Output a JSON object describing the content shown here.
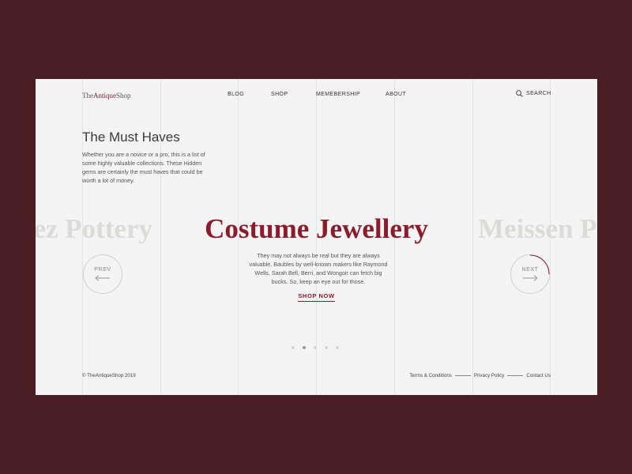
{
  "logo": {
    "prefix": "The",
    "accent": "Antique",
    "suffix": "Shop"
  },
  "nav": [
    "BLOG",
    "SHOP",
    "MEMEBERSHIP",
    "ABOUT"
  ],
  "search_label": "SEARCH",
  "intro": {
    "title": "The Must Haves",
    "text": "Whether you are a novice or a pro, this is a list of some highly valuable collections. These Hidden gems are certainly the must haves that could be worth a lot of money."
  },
  "carousel": {
    "prev_item": "nez Pottery",
    "current_item": "Costume Jewellery",
    "next_item": "Meissen P",
    "description": "They may not always be real but they are always valuable. Baubles by well-known makers like Raymond Wells, Sarah Bell, Berri, and Wongoir can fetch big bucks. So, keep an eye out for those.",
    "cta": "SHOP NOW",
    "prev_label": "PREV",
    "next_label": "NEXT",
    "dot_count": 5,
    "active_index": 1
  },
  "footer": {
    "copyright": "© TheAntiqueShop 2019",
    "links": [
      "Terms & Conditions",
      "Privacy Policy",
      "Contact Us"
    ]
  },
  "colors": {
    "accent": "#8a1c2c",
    "background": "#4a1e25",
    "card": "#f4f4f4"
  }
}
